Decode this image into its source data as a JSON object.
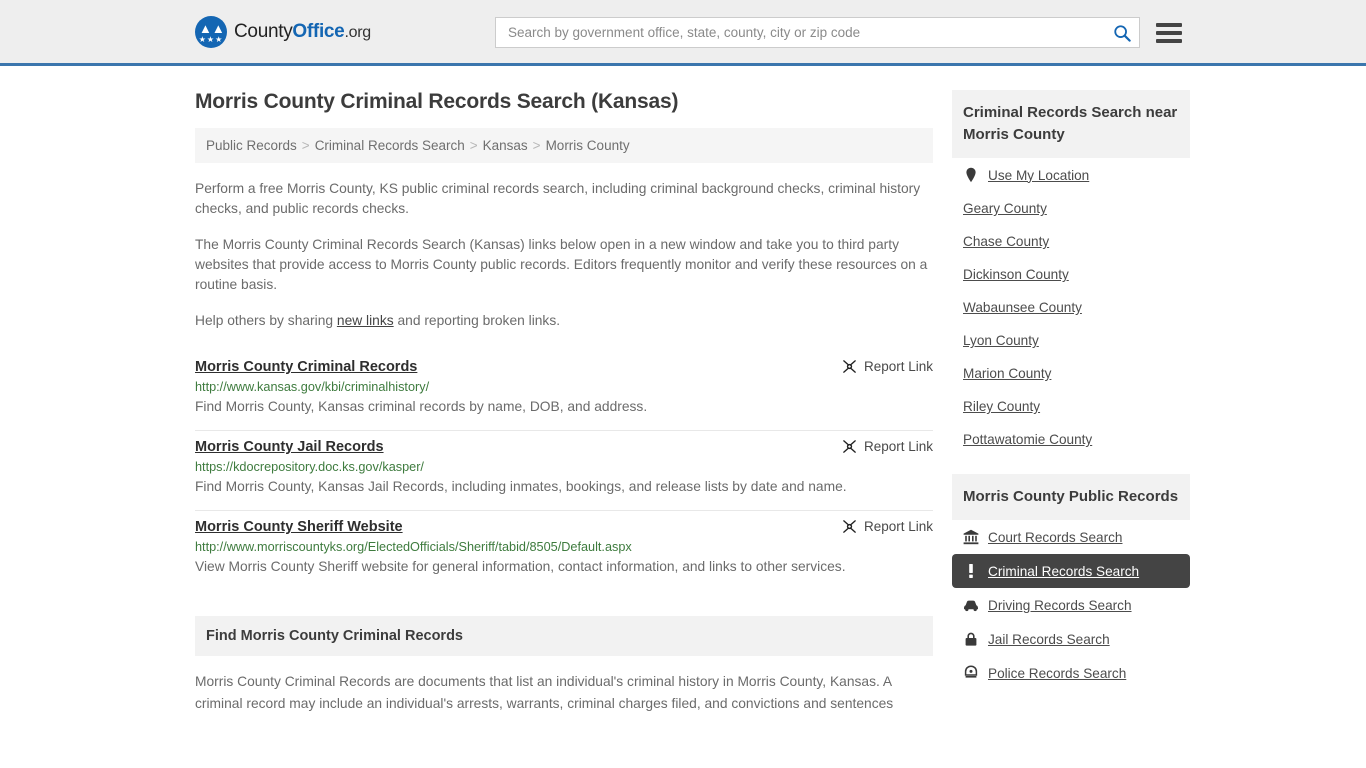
{
  "header": {
    "logo": {
      "part1": "County",
      "part2": "Office",
      "part3": ".org",
      "icon": "eagle-shield-icon"
    },
    "search": {
      "placeholder": "Search by government office, state, county, city or zip code",
      "value": "",
      "icon": "search-icon"
    },
    "menu_icon": "hamburger-menu-icon"
  },
  "page": {
    "title": "Morris County Criminal Records Search (Kansas)"
  },
  "breadcrumb": {
    "separator": ">",
    "items": [
      {
        "label": "Public Records"
      },
      {
        "label": "Criminal Records Search"
      },
      {
        "label": "Kansas"
      },
      {
        "label": "Morris County"
      }
    ]
  },
  "intro": {
    "p1": "Perform a free Morris County, KS public criminal records search, including criminal background checks, criminal history checks, and public records checks.",
    "p2": "The Morris County Criminal Records Search (Kansas) links below open in a new window and take you to third party websites that provide access to Morris County public records. Editors frequently monitor and verify these resources on a routine basis.",
    "p3_before": "Help others by sharing ",
    "p3_link": "new links",
    "p3_after": " and reporting broken links."
  },
  "results": {
    "report_label": "Report Link",
    "report_icon": "broken-link-icon",
    "items": [
      {
        "title": "Morris County Criminal Records",
        "url": "http://www.kansas.gov/kbi/criminalhistory/",
        "description": "Find Morris County, Kansas criminal records by name, DOB, and address."
      },
      {
        "title": "Morris County Jail Records",
        "url": "https://kdocrepository.doc.ks.gov/kasper/",
        "description": "Find Morris County, Kansas Jail Records, including inmates, bookings, and release lists by date and name."
      },
      {
        "title": "Morris County Sheriff Website",
        "url": "http://www.morriscountyks.org/ElectedOfficials/Sheriff/tabid/8505/Default.aspx",
        "description": "View Morris County Sheriff website for general information, contact information, and links to other services."
      }
    ]
  },
  "find_section": {
    "heading": "Find Morris County Criminal Records",
    "body": "Morris County Criminal Records are documents that list an individual's criminal history in Morris County, Kansas. A criminal record may include an individual's arrests, warrants, criminal charges filed, and convictions and sentences"
  },
  "sidebar": {
    "nearby": {
      "heading": "Criminal Records Search near Morris County",
      "items": [
        {
          "label": "Use My Location",
          "icon": "map-pin-icon"
        },
        {
          "label": "Geary County",
          "icon": ""
        },
        {
          "label": "Chase County",
          "icon": ""
        },
        {
          "label": "Dickinson County",
          "icon": ""
        },
        {
          "label": "Wabaunsee County",
          "icon": ""
        },
        {
          "label": "Lyon County",
          "icon": ""
        },
        {
          "label": "Marion County",
          "icon": ""
        },
        {
          "label": "Riley County",
          "icon": ""
        },
        {
          "label": "Pottawatomie County",
          "icon": ""
        }
      ]
    },
    "public_records": {
      "heading": "Morris County Public Records",
      "items": [
        {
          "label": "Court Records Search",
          "icon": "courthouse-icon",
          "active": false
        },
        {
          "label": "Criminal Records Search",
          "icon": "exclamation-icon",
          "active": true
        },
        {
          "label": "Driving Records Search",
          "icon": "car-icon",
          "active": false
        },
        {
          "label": "Jail Records Search",
          "icon": "lock-icon",
          "active": false
        },
        {
          "label": "Police Records Search",
          "icon": "police-badge-icon",
          "active": false
        }
      ]
    }
  },
  "colors": {
    "brand_blue": "#1466b3",
    "header_rule": "#3b76ad",
    "url_green": "#3e7b3e",
    "active_bg": "#444444",
    "panel_gray": "#f2f2f2"
  }
}
